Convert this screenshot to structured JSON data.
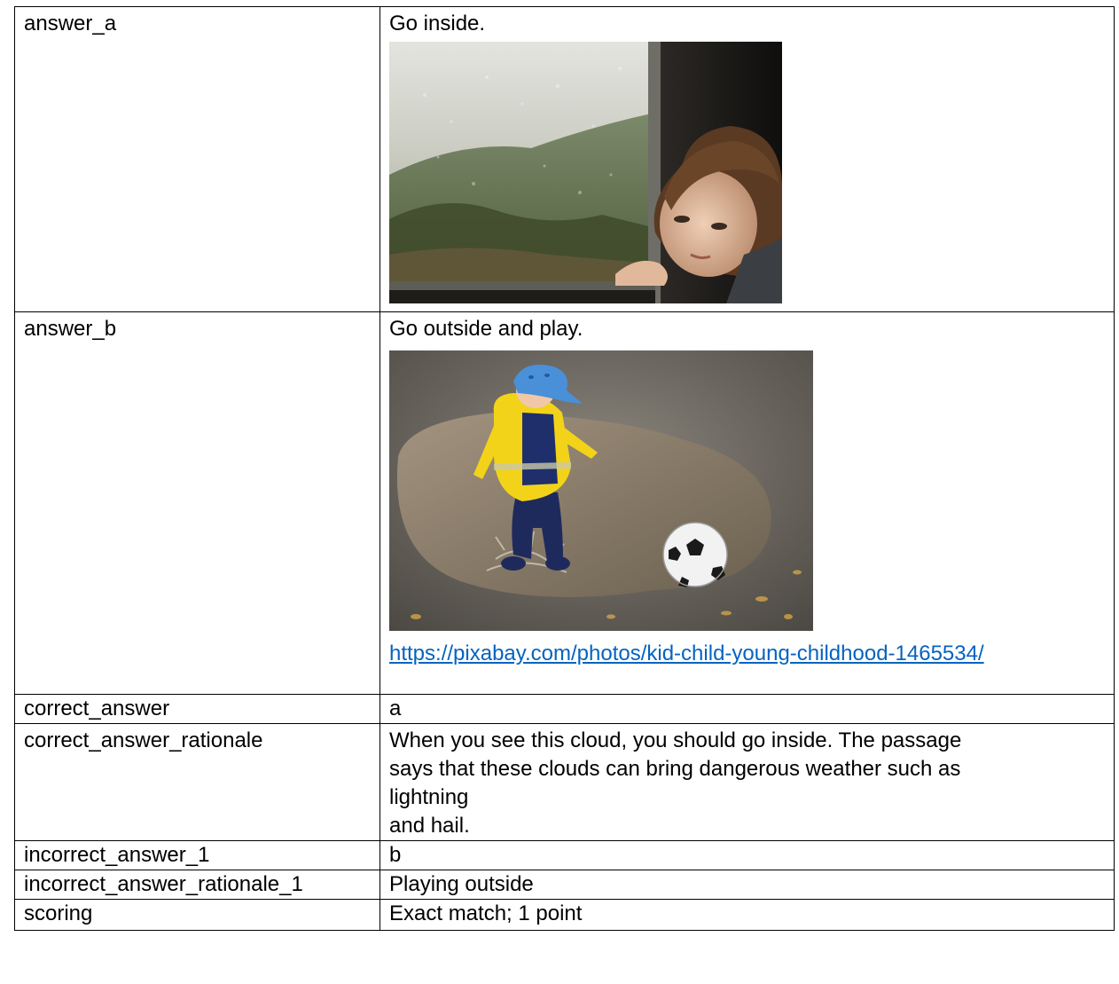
{
  "rows": {
    "answer_a": {
      "key": "answer_a",
      "value": "Go inside.",
      "image_icon": "photo-child-at-rainy-window"
    },
    "answer_b": {
      "key": "answer_b",
      "value": "Go outside and play.",
      "image_icon": "photo-child-kicking-ball-in-puddle",
      "link": "https://pixabay.com/photos/kid-child-young-childhood-1465534/"
    },
    "correct_answer": {
      "key": "correct_answer",
      "value": "a"
    },
    "correct_answer_rationale": {
      "key": "correct_answer_rationale",
      "lines": [
        "When you see this cloud, you should go inside. The passage",
        "says that these clouds can bring dangerous weather such as",
        "lightning",
        "and hail."
      ]
    },
    "incorrect_answer_1": {
      "key": "incorrect_answer_1",
      "value": "b"
    },
    "incorrect_answer_rationale_1": {
      "key": "incorrect_answer_rationale_1",
      "value": "Playing outside"
    },
    "scoring": {
      "key": "scoring",
      "value": "Exact match; 1 point"
    }
  },
  "colors": {
    "link": "#0563c1",
    "border": "#000000"
  }
}
